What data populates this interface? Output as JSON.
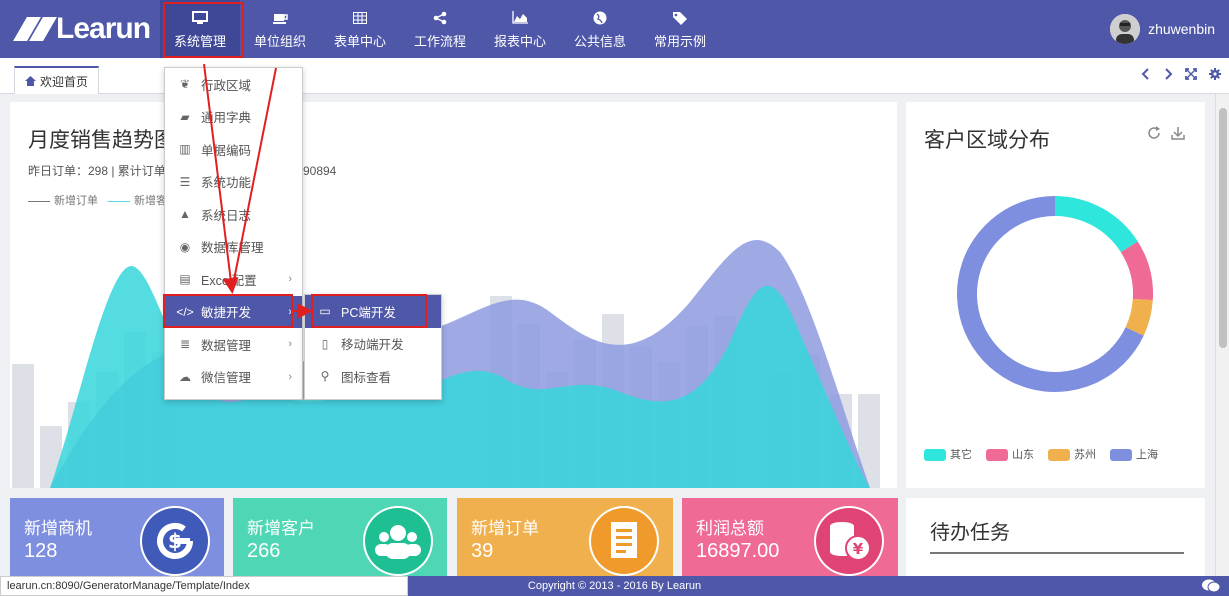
{
  "app": {
    "logo_text": "Learun"
  },
  "nav": {
    "items": [
      {
        "label": "系统管理",
        "icon": "monitor-icon"
      },
      {
        "label": "单位组织",
        "icon": "coffee-icon"
      },
      {
        "label": "表单中心",
        "icon": "table-icon"
      },
      {
        "label": "工作流程",
        "icon": "share-icon"
      },
      {
        "label": "报表中心",
        "icon": "area-chart-icon"
      },
      {
        "label": "公共信息",
        "icon": "globe-icon"
      },
      {
        "label": "常用示例",
        "icon": "tags-icon"
      }
    ],
    "active": 0
  },
  "user": {
    "name": "zhuwenbin"
  },
  "tabs": {
    "items": [
      {
        "label": "欢迎首页",
        "icon": "home-icon"
      }
    ]
  },
  "tab_tools": [
    "chevron-left-icon",
    "chevron-right-icon",
    "expand-icon",
    "gear-icon"
  ],
  "sales_chart": {
    "title": "月度销售趋势图",
    "stats": "昨日订单：298 | 累计订单：      9840 | 累计交易额：1890894",
    "legend": [
      "新增订单",
      "新增客户"
    ]
  },
  "pie": {
    "title": "客户区域分布",
    "tools": [
      "refresh-icon",
      "download-icon"
    ],
    "legend": [
      {
        "name": "其它",
        "color": "#2fe6dc"
      },
      {
        "name": "山东",
        "color": "#f06a96"
      },
      {
        "name": "苏州",
        "color": "#f0b04e"
      },
      {
        "name": "上海",
        "color": "#7f8fe0"
      }
    ]
  },
  "chart_data": {
    "type": "pie",
    "title": "客户区域分布",
    "categories": [
      "其它",
      "山东",
      "苏州",
      "上海"
    ],
    "values": [
      16,
      10,
      6,
      68
    ],
    "legend_position": "bottom"
  },
  "cards": [
    {
      "label": "新增商机",
      "value": "128",
      "color": "#7f8fe0",
      "icon": "refresh-g-icon",
      "icon_color": "#3f5ab8"
    },
    {
      "label": "新增客户",
      "value": "266",
      "color": "#4fd6b4",
      "icon": "users-icon",
      "icon_color": "#1fbf94"
    },
    {
      "label": "新增订单",
      "value": "39",
      "color": "#f0b04e",
      "icon": "document-icon",
      "icon_color": "#f09a2c"
    },
    {
      "label": "利润总额",
      "value": "16897.00",
      "color": "#f06a96",
      "icon": "coins-yen-icon",
      "icon_color": "#e04474"
    }
  ],
  "todo": {
    "title": "待办任务"
  },
  "menu": {
    "items": [
      {
        "label": "行政区域",
        "icon": "leaf-icon",
        "has_sub": false
      },
      {
        "label": "通用字典",
        "icon": "book-icon",
        "has_sub": false
      },
      {
        "label": "单据编码",
        "icon": "barcode-icon",
        "has_sub": false
      },
      {
        "label": "系统功能",
        "icon": "list-icon",
        "has_sub": false
      },
      {
        "label": "系统日志",
        "icon": "warning-icon",
        "has_sub": false
      },
      {
        "label": "数据库管理",
        "icon": "disc-icon",
        "has_sub": false
      },
      {
        "label": "Excel配置",
        "icon": "excel-icon",
        "has_sub": true
      },
      {
        "label": "敏捷开发",
        "icon": "code-icon",
        "has_sub": true
      },
      {
        "label": "数据管理",
        "icon": "database-icon",
        "has_sub": true
      },
      {
        "label": "微信管理",
        "icon": "wechat-icon",
        "has_sub": true
      }
    ],
    "highlighted": 7
  },
  "submenu": {
    "items": [
      {
        "label": "PC端开发",
        "icon": "monitor-icon"
      },
      {
        "label": "移动端开发",
        "icon": "mobile-icon"
      },
      {
        "label": "图标查看",
        "icon": "search-icon"
      }
    ],
    "highlighted": 0
  },
  "footer": {
    "copyright": "Copyright © 2013 - 2016 By Learun",
    "status_url": "learun.cn:8090/GeneratorManage/Template/Index"
  },
  "colors": {
    "primary": "#4f58a8",
    "teal": "#2fe6dc",
    "purple": "#7f8fe0"
  }
}
